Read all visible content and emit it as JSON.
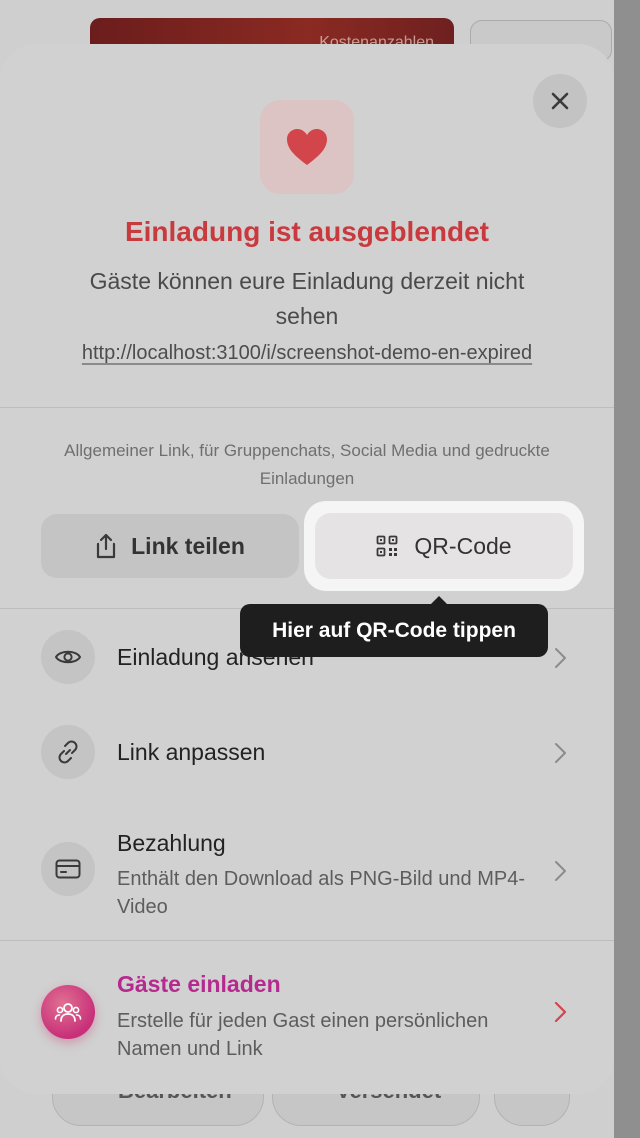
{
  "background": {
    "banner_text": "Kostenanzahlen",
    "bottom_left_label": "Bearbeiten",
    "bottom_mid_label": "Versendet"
  },
  "sheet": {
    "close_icon": "close-icon",
    "title": "Einladung ist ausgeblendet",
    "subtitle": "Gäste können eure Einladung derzeit nicht sehen",
    "url": "http://localhost:3100/i/screenshot-demo-en-expired",
    "share_hint": "Allgemeiner Link, für Gruppenchats, Social Media und gedruckte Einladungen",
    "share_button": "Link teilen",
    "qr_button": "QR-Code",
    "tooltip": "Hier auf QR-Code tippen",
    "rows": [
      {
        "title": "Einladung ansehen",
        "icon": "eye-icon"
      },
      {
        "title": "Link anpassen",
        "icon": "link-icon"
      },
      {
        "title": "Bezahlung",
        "desc": "Enthält den Download als PNG-Bild und MP4-Video",
        "icon": "card-icon"
      },
      {
        "title": "Gäste einladen",
        "desc": "Erstelle für jeden Gast einen persönlichen Namen und Link",
        "icon": "guests-icon"
      }
    ]
  },
  "colors": {
    "accent_red": "#c93a3f",
    "accent_magenta": "#b52a8f"
  }
}
